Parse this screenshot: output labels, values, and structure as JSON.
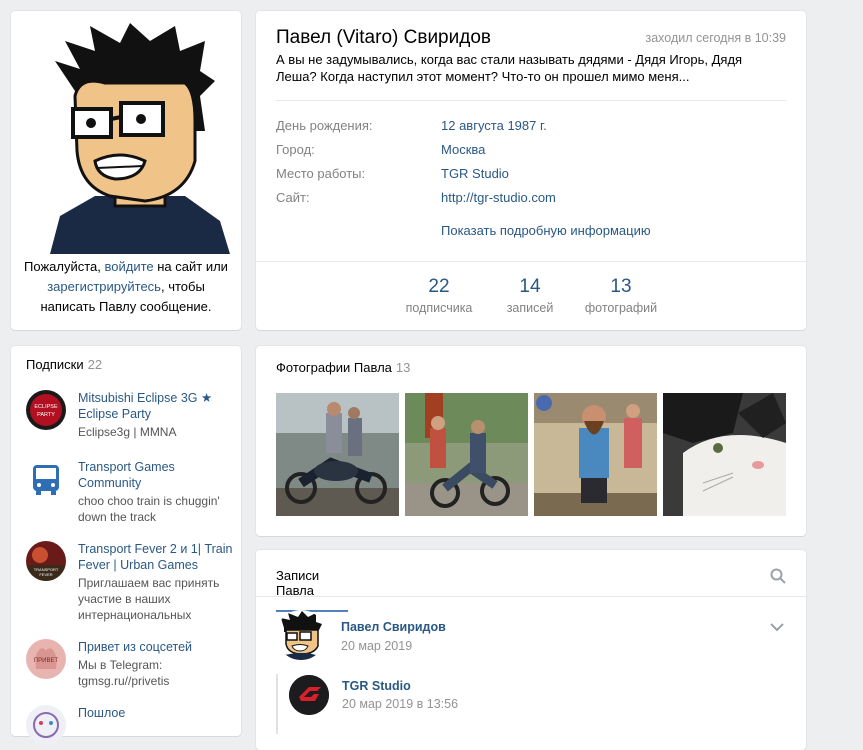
{
  "avatar": {
    "login_prefix": "Пожалуйста, ",
    "login_link": "войдите",
    "login_middle": " на сайт или ",
    "register_link": "зарегистрируйтесь",
    "login_suffix": ", чтобы написать Павлу сообщение."
  },
  "profile": {
    "name": "Павел (Vitaro) Свиридов",
    "last_seen": "заходил сегодня в 10:39",
    "status": "А вы не задумывались, когда вас стали называть дядями - Дядя Игорь, Дядя Леша? Когда наступил этот момент? Что-то он прошел мимо меня...",
    "fields": [
      {
        "label": "День рождения:",
        "value": "12 августа 1987 г."
      },
      {
        "label": "Город:",
        "value": "Москва"
      },
      {
        "label": "Место работы:",
        "value": "TGR Studio"
      },
      {
        "label": "Сайт:",
        "value": "http://tgr-studio.com"
      }
    ],
    "more_info": "Показать подробную информацию",
    "counters": [
      {
        "num": "22",
        "label": "подписчика"
      },
      {
        "num": "14",
        "label": "записей"
      },
      {
        "num": "13",
        "label": "фотографий"
      }
    ]
  },
  "subscriptions": {
    "title": "Подписки",
    "count": "22",
    "items": [
      {
        "title": "Mitsubishi Eclipse 3G ★ Eclipse Party",
        "desc": "Eclipse3g | MMNA",
        "icon": "eclipse-party-logo",
        "icon_text": "ECLIPSE PARTY"
      },
      {
        "title": "Transport Games Community",
        "desc": "choo choo train is chuggin' down the track",
        "icon": "bus-icon"
      },
      {
        "title": "Transport Fever 2 и 1| Train Fever | Urban Games",
        "desc": "Приглашаем вас принять участие в наших интернациональных",
        "icon": "transport-fever-logo",
        "icon_text": "TRANSPORT FEVER"
      },
      {
        "title": "Привет из соцсетей",
        "desc": "Мы в Telegram: tgmsg.ru//privetis",
        "icon": "privet-logo",
        "icon_text": "ПРИВЕТ"
      },
      {
        "title": "Пошлое",
        "desc": "",
        "icon": "poshloe-logo"
      }
    ]
  },
  "photos": {
    "title": "Фотографии Павла",
    "count": "13",
    "items": [
      "bikers-photo-1",
      "bikers-photo-2",
      "bearded-man-photo",
      "cat-photo"
    ]
  },
  "wall": {
    "tab_label": "Записи Павла",
    "post": {
      "author": "Павел Свиридов",
      "date": "20 мар 2019"
    },
    "repost": {
      "author": "TGR Studio",
      "date": "20 мар 2019 в 13:56"
    }
  },
  "colors": {
    "link": "#2a5885",
    "muted": "#939393",
    "background": "#edeef0",
    "accent": "#5181b8"
  }
}
